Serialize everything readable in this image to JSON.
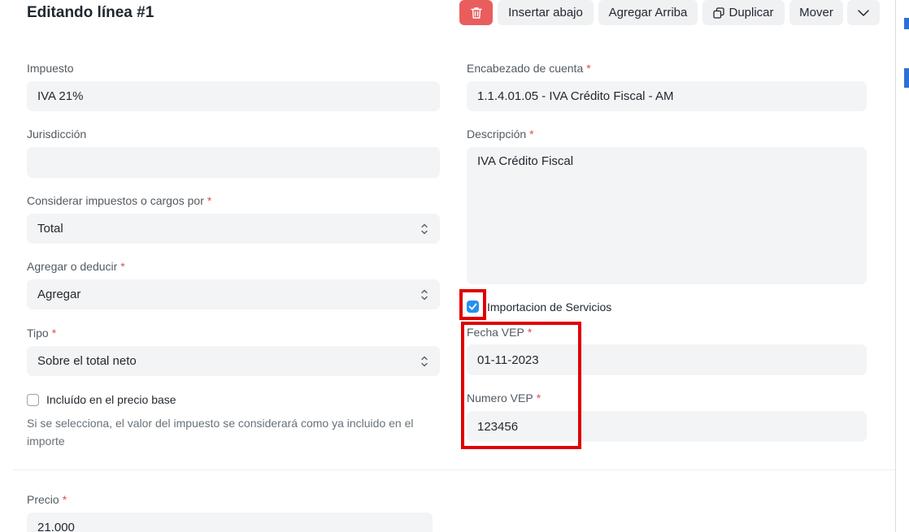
{
  "dialog": {
    "title": "Editando línea #1"
  },
  "toolbar": {
    "delete_icon": "trash-icon",
    "insert_below": "Insertar abajo",
    "add_above": "Agregar Arriba",
    "duplicate": "Duplicar",
    "duplicate_icon": "copy-icon",
    "move": "Mover",
    "more_icon": "chevron-down-icon",
    "delete_color": "#e95d5d"
  },
  "left": {
    "impuesto": {
      "label": "Impuesto",
      "value": "IVA 21%"
    },
    "jurisdiccion": {
      "label": "Jurisdicción",
      "value": ""
    },
    "considerar": {
      "label": "Considerar impuestos o cargos por",
      "value": "Total"
    },
    "agregar": {
      "label": "Agregar o deducir",
      "value": "Agregar"
    },
    "tipo": {
      "label": "Tipo",
      "value": "Sobre el total neto"
    },
    "incluido": {
      "label": "Incluído en el precio base",
      "checked": false,
      "help_line1": "Si se selecciona, el valor del impuesto se considerará como ya incluido en el",
      "help_line2": "importe"
    }
  },
  "right": {
    "cuenta": {
      "label": "Encabezado de cuenta",
      "value": "1.1.4.01.05 - IVA Crédito Fiscal - AM"
    },
    "descripcion": {
      "label": "Descripción",
      "value": "IVA Crédito Fiscal"
    },
    "importacion": {
      "label": "Importacion de Servicios",
      "checked": true
    },
    "fecha_vep": {
      "label": "Fecha VEP",
      "value": "01-11-2023"
    },
    "numero_vep": {
      "label": "Numero VEP",
      "value": "123456"
    }
  },
  "bottom": {
    "precio": {
      "label": "Precio",
      "value": "21.000"
    }
  },
  "colors": {
    "required": "#e24c4c",
    "checkbox_on": "#2490ef",
    "highlight": "#e00000",
    "field_bg": "#f3f4f6"
  }
}
